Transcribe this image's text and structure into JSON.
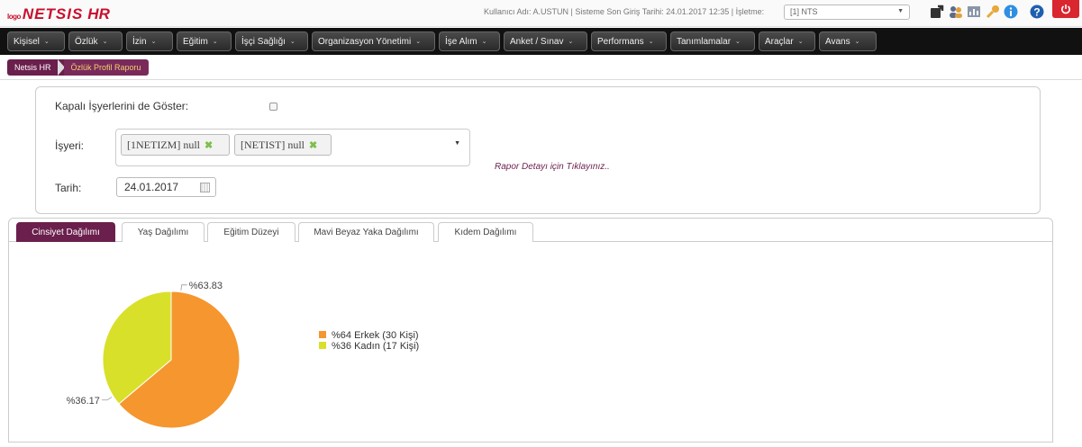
{
  "header": {
    "logo_prefix": "logo",
    "logo_text": "NETSIS",
    "logo_suffix": "HR",
    "user_info": "Kullanıcı Adı: A.USTUN | Sisteme Son Giriş Tarihi: 24.01.2017 12:35 | İşletme:",
    "company_select_value": "[1] NTS",
    "icons": [
      "external-link-icon",
      "users-icon",
      "chart-icon",
      "key-icon",
      "info-icon",
      "help-icon",
      "power-icon"
    ],
    "colors": {
      "brand": "#c8102e",
      "logout": "#d9262f"
    }
  },
  "menu": {
    "items": [
      "Kişisel",
      "Özlük",
      "İzin",
      "Eğitim",
      "İşçi Sağlığı",
      "Organizasyon Yönetimi",
      "İşe Alım",
      "Anket / Sınav",
      "Performans",
      "Tanımlamalar",
      "Araçlar",
      "Avans"
    ]
  },
  "breadcrumb": {
    "items": [
      "Netsis HR",
      "Özlük Profil Raporu"
    ]
  },
  "filters": {
    "closed_workplaces_label": "Kapalı İşyerlerini de Göster:",
    "closed_workplaces_checked": false,
    "workplace_label": "İşyeri:",
    "workplace_tags": [
      "[1NETIZM] null",
      "[NETIST] null"
    ],
    "report_detail_link": "Rapor Detayı için Tıklayınız..",
    "date_label": "Tarih:",
    "date_value": "24.01.2017"
  },
  "tabs": {
    "items": [
      "Cinsiyet Dağılımı",
      "Yaş Dağılımı",
      "Eğitim Düzeyi",
      "Mavi Beyaz Yaka Dağılımı",
      "Kıdem Dağılımı"
    ],
    "active_index": 0,
    "active_color": "#6b1f4d"
  },
  "chart_data": {
    "type": "pie",
    "title": "",
    "slices": [
      {
        "label": "%63.83",
        "value": 63.83,
        "legend": "%64 Erkek (30 Kişi)",
        "color": "#f5962f"
      },
      {
        "label": "%36.17",
        "value": 36.17,
        "legend": "%36 Kadın (17 Kişi)",
        "color": "#d9e02a"
      }
    ],
    "legend_position": "right"
  }
}
